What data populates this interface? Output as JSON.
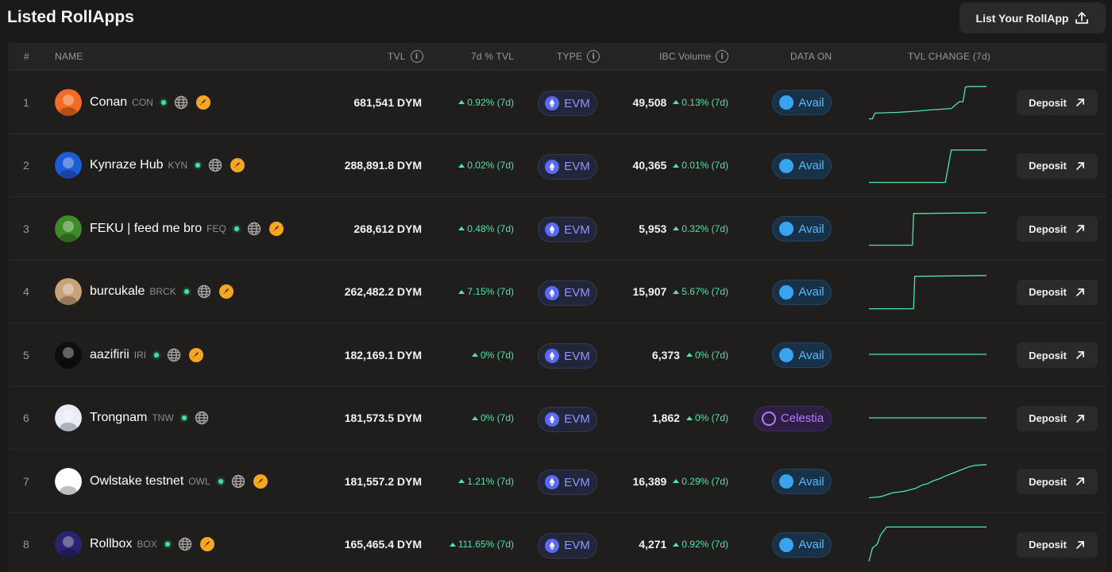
{
  "page": {
    "title": "Listed RollApps",
    "list_button": "List Your RollApp"
  },
  "columns": {
    "rank": "#",
    "name": "NAME",
    "tvl": "TVL",
    "tvl_pct": "7d % TVL",
    "type": "TYPE",
    "ibc": "IBC Volume",
    "data_on": "DATA ON",
    "tvl_change": "TVL CHANGE (7d)"
  },
  "colors": {
    "accent_green": "#4fe3b0",
    "evm": "#8e97ff",
    "avail": "#5ab8ff",
    "celestia": "#b57bff"
  },
  "rows": [
    {
      "rank": "1",
      "name": "Conan",
      "ticker": "CON",
      "avatar": "conan-avatar",
      "avatar_color": "#f36b24",
      "badge": true,
      "tvl": "681,541 DYM",
      "tvl_pct": "0.92% (7d)",
      "type": "EVM",
      "ibc": "49,508",
      "ibc_pct": "0.13% (7d)",
      "data_on": "Avail",
      "deposit": "Deposit"
    },
    {
      "rank": "2",
      "name": "Kynraze Hub",
      "ticker": "KYN",
      "avatar": "kynraze-avatar",
      "avatar_color": "#1e5bd6",
      "badge": true,
      "tvl": "288,891.8 DYM",
      "tvl_pct": "0.02% (7d)",
      "type": "EVM",
      "ibc": "40,365",
      "ibc_pct": "0.01% (7d)",
      "data_on": "Avail",
      "deposit": "Deposit"
    },
    {
      "rank": "3",
      "name": "FEKU | feed me bro",
      "ticker": "FEQ",
      "avatar": "feku-avatar",
      "avatar_color": "#3f8a2a",
      "badge": true,
      "tvl": "268,612 DYM",
      "tvl_pct": "0.48% (7d)",
      "type": "EVM",
      "ibc": "5,953",
      "ibc_pct": "0.32% (7d)",
      "data_on": "Avail",
      "deposit": "Deposit"
    },
    {
      "rank": "4",
      "name": "burcukale",
      "ticker": "BRCK",
      "avatar": "burcukale-avatar",
      "avatar_color": "#c9a27a",
      "badge": true,
      "tvl": "262,482.2 DYM",
      "tvl_pct": "7.15% (7d)",
      "type": "EVM",
      "ibc": "15,907",
      "ibc_pct": "5.67% (7d)",
      "data_on": "Avail",
      "deposit": "Deposit"
    },
    {
      "rank": "5",
      "name": "aazifirii",
      "ticker": "IRI",
      "avatar": "aazifirii-avatar",
      "avatar_color": "#0e0e0e",
      "badge": true,
      "tvl": "182,169.1 DYM",
      "tvl_pct": "0% (7d)",
      "type": "EVM",
      "ibc": "6,373",
      "ibc_pct": "0% (7d)",
      "data_on": "Avail",
      "deposit": "Deposit"
    },
    {
      "rank": "6",
      "name": "Trongnam",
      "ticker": "TNW",
      "avatar": "trongnam-avatar",
      "avatar_color": "#e8ecf5",
      "badge": false,
      "tvl": "181,573.5 DYM",
      "tvl_pct": "0% (7d)",
      "type": "EVM",
      "ibc": "1,862",
      "ibc_pct": "0% (7d)",
      "data_on": "Celestia",
      "deposit": "Deposit"
    },
    {
      "rank": "7",
      "name": "Owlstake testnet",
      "ticker": "OWL",
      "avatar": "owlstake-avatar",
      "avatar_color": "#ffffff",
      "badge": true,
      "tvl": "181,557.2 DYM",
      "tvl_pct": "1.21% (7d)",
      "type": "EVM",
      "ibc": "16,389",
      "ibc_pct": "0.29% (7d)",
      "data_on": "Avail",
      "deposit": "Deposit"
    },
    {
      "rank": "8",
      "name": "Rollbox",
      "ticker": "BOX",
      "avatar": "rollbox-avatar",
      "avatar_color": "#2a2370",
      "badge": true,
      "tvl": "165,465.4 DYM",
      "tvl_pct": "111.65% (7d)",
      "type": "EVM",
      "ibc": "4,271",
      "ibc_pct": "0.92% (7d)",
      "data_on": "Avail",
      "deposit": "Deposit"
    }
  ]
}
